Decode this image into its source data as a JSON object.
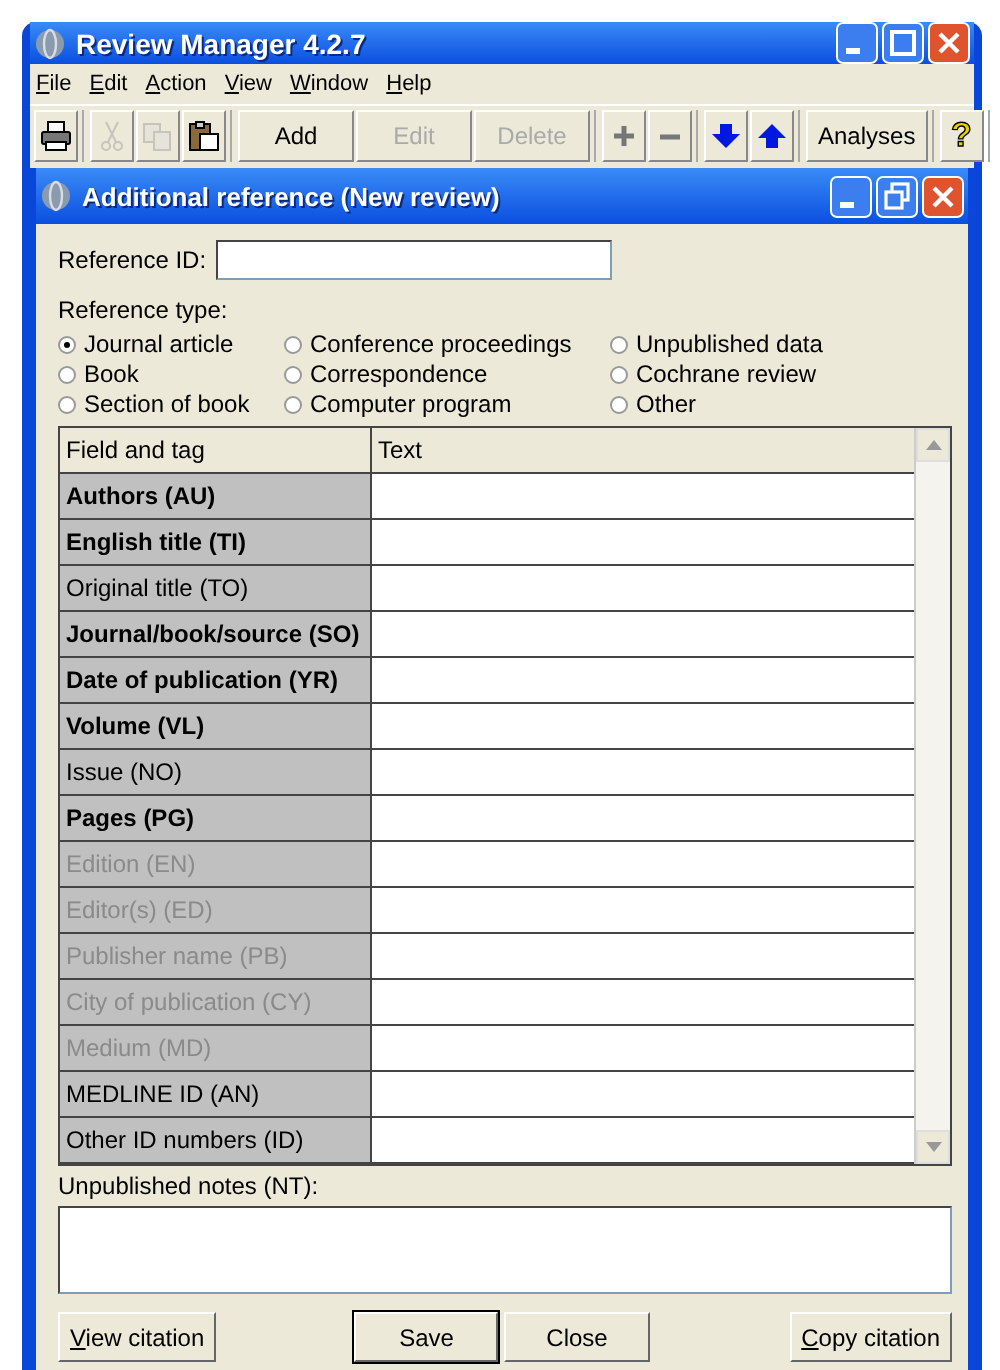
{
  "window": {
    "title": "Review Manager 4.2.7"
  },
  "menu": [
    "File",
    "Edit",
    "Action",
    "View",
    "Window",
    "Help"
  ],
  "toolbar": [
    [
      {
        "kind": "print",
        "disabled": false
      }
    ],
    [
      {
        "kind": "cut",
        "disabled": true
      },
      {
        "kind": "copy",
        "disabled": true
      },
      {
        "kind": "paste",
        "disabled": false
      }
    ],
    [
      {
        "kind": "text",
        "label": "Add",
        "disabled": false
      },
      {
        "kind": "text",
        "label": "Edit",
        "disabled": true
      },
      {
        "kind": "text",
        "label": "Delete",
        "disabled": true
      }
    ],
    [
      {
        "kind": "plus",
        "disabled": false
      },
      {
        "kind": "minus",
        "disabled": false
      }
    ],
    [
      {
        "kind": "down",
        "disabled": false
      },
      {
        "kind": "up",
        "disabled": false
      }
    ],
    [
      {
        "kind": "text",
        "label": "Analyses",
        "disabled": false
      }
    ],
    [
      {
        "kind": "help",
        "label": "?",
        "disabled": false
      }
    ]
  ],
  "dialog": {
    "title": "Additional reference (New review)",
    "reference_id": {
      "label": "Reference ID:"
    },
    "reference_type": {
      "label": "Reference type:",
      "options": [
        {
          "label": "Journal article",
          "selected": true
        },
        {
          "label": "Conference proceedings",
          "selected": false
        },
        {
          "label": "Unpublished data",
          "selected": false
        },
        {
          "label": "Book",
          "selected": false
        },
        {
          "label": "Correspondence",
          "selected": false
        },
        {
          "label": "Cochrane review",
          "selected": false
        },
        {
          "label": "Section of book",
          "selected": false
        },
        {
          "label": "Computer program",
          "selected": false
        },
        {
          "label": "Other",
          "selected": false
        }
      ]
    },
    "table": {
      "columns": [
        "Field and tag",
        "Text"
      ],
      "rows": [
        {
          "field": "Authors (AU)",
          "required": true,
          "disabled": false
        },
        {
          "field": "English title (TI)",
          "required": true,
          "disabled": false
        },
        {
          "field": "Original title (TO)",
          "required": false,
          "disabled": false
        },
        {
          "field": "Journal/book/source (SO)",
          "required": true,
          "disabled": false
        },
        {
          "field": "Date of publication (YR)",
          "required": true,
          "disabled": false
        },
        {
          "field": "Volume (VL)",
          "required": true,
          "disabled": false
        },
        {
          "field": "Issue (NO)",
          "required": false,
          "disabled": false
        },
        {
          "field": "Pages (PG)",
          "required": true,
          "disabled": false
        },
        {
          "field": "Edition (EN)",
          "required": false,
          "disabled": true
        },
        {
          "field": "Editor(s) (ED)",
          "required": false,
          "disabled": true
        },
        {
          "field": "Publisher name (PB)",
          "required": false,
          "disabled": true
        },
        {
          "field": "City of publication (CY)",
          "required": false,
          "disabled": true
        },
        {
          "field": "Medium (MD)",
          "required": false,
          "disabled": true
        },
        {
          "field": "MEDLINE ID (AN)",
          "required": false,
          "disabled": false
        },
        {
          "field": "Other ID numbers (ID)",
          "required": false,
          "disabled": false
        }
      ]
    },
    "notes": {
      "label": "Unpublished notes (NT):"
    },
    "buttons": [
      {
        "label": "View citation",
        "kind": "left",
        "default": false
      },
      {
        "label": "Save",
        "kind": "center",
        "default": true
      },
      {
        "label": "Close",
        "kind": "center",
        "default": false
      },
      {
        "label": "Copy citation",
        "kind": "right",
        "default": false
      }
    ]
  }
}
